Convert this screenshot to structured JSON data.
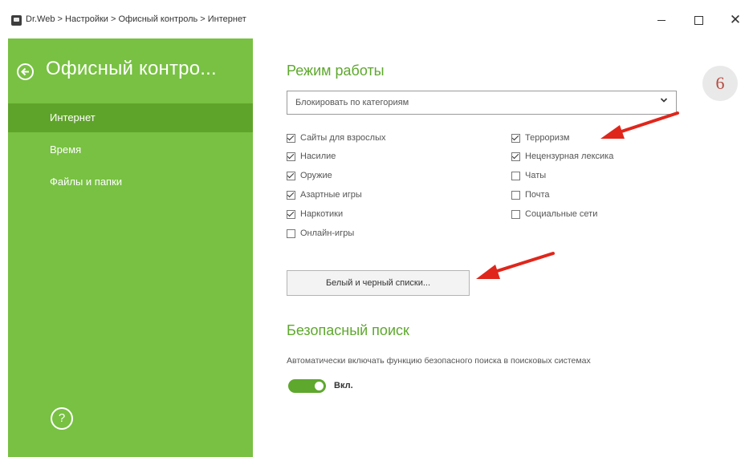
{
  "window": {
    "title": "Dr.Web > Настройки > Офисный контроль > Интернет",
    "minimize_icon": "minimize-icon",
    "maximize_icon": "maximize-icon",
    "close_icon": "close-icon",
    "close_glyph": "✕"
  },
  "sidebar": {
    "title": "Офисный контро...",
    "background": "#78c142",
    "active_background": "#5fa42a",
    "items": [
      {
        "label": "Интернет",
        "active": true
      },
      {
        "label": "Время",
        "active": false
      },
      {
        "label": "Файлы и папки",
        "active": false
      }
    ],
    "help_glyph": "?"
  },
  "mode": {
    "title": "Режим работы",
    "select_value": "Блокировать по категориям",
    "select_chevron": "❯",
    "categories_left": [
      {
        "label": "Сайты для взрослых",
        "checked": true
      },
      {
        "label": "Насилие",
        "checked": true
      },
      {
        "label": "Оружие",
        "checked": true
      },
      {
        "label": "Азартные игры",
        "checked": true
      },
      {
        "label": "Наркотики",
        "checked": true
      },
      {
        "label": "Онлайн-игры",
        "checked": false
      }
    ],
    "categories_right": [
      {
        "label": "Терроризм",
        "checked": true
      },
      {
        "label": "Нецензурная лексика",
        "checked": true
      },
      {
        "label": "Чаты",
        "checked": false
      },
      {
        "label": "Почта",
        "checked": false
      },
      {
        "label": "Социальные сети",
        "checked": false
      }
    ],
    "lists_button": "Белый и черный списки..."
  },
  "safe_search": {
    "title": "Безопасный поиск",
    "description": "Автоматически включать функцию безопасного поиска в поисковых системах",
    "toggle_on": true,
    "toggle_label": "Вкл."
  },
  "annotation": {
    "badge": "6",
    "badge_color": "#b84a3f",
    "arrow_color": "#e0261b"
  },
  "accent_color": "#5ea82d"
}
